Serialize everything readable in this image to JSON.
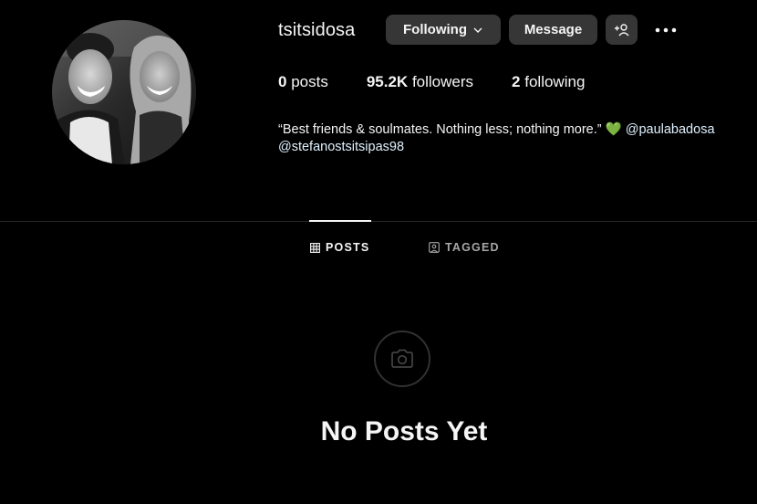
{
  "profile": {
    "username": "tsitsidosa",
    "following_button": "Following",
    "message_button": "Message"
  },
  "stats": {
    "posts_count": "0",
    "posts_label": "posts",
    "followers_count": "95.2K",
    "followers_label": "followers",
    "following_count": "2",
    "following_label": "following"
  },
  "bio": {
    "text": "“Best friends & soulmates. Nothing less; nothing more.”",
    "emoji": "💚",
    "mention1": "@paulabadosa",
    "mention2": "@stefanostsitsipas98"
  },
  "tabs": [
    {
      "label": "POSTS",
      "active": true
    },
    {
      "label": "TAGGED",
      "active": false
    }
  ],
  "empty_state": {
    "title": "No Posts Yet"
  },
  "icons": {
    "chevron": "chevron-down-icon",
    "add_person": "add-person-icon",
    "more": "more-options-icon",
    "grid": "grid-icon",
    "tagged": "tagged-icon",
    "camera": "camera-icon"
  }
}
